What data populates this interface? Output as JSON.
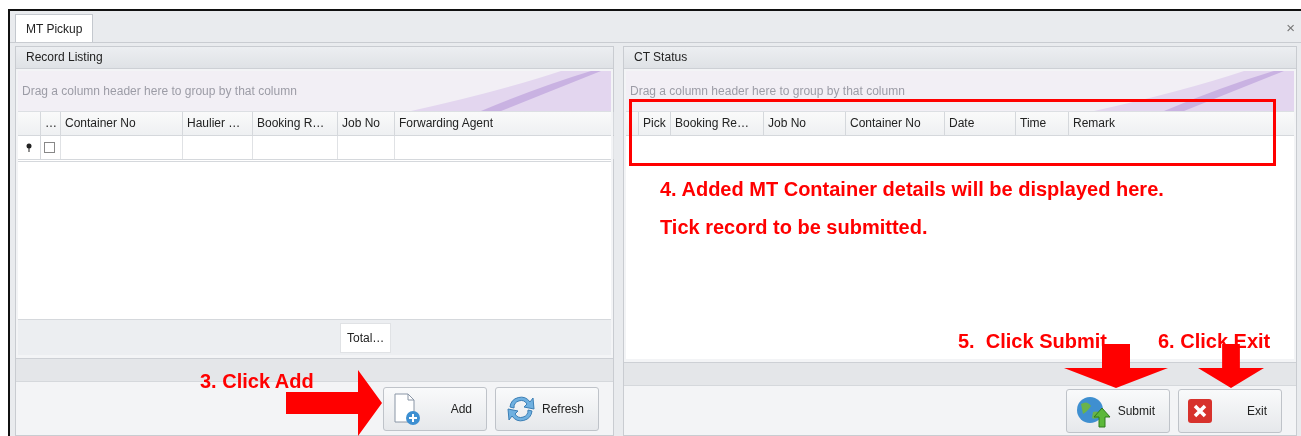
{
  "window": {
    "close": "×"
  },
  "tabs": [
    {
      "label": "MT Pickup",
      "selected": true
    }
  ],
  "left_panel": {
    "title": "Record Listing",
    "group_hint": "Drag a column header here to group by that column",
    "columns": [
      "…",
      "Container No",
      "Haulier …",
      "Booking R…",
      "Job No",
      "Forwarding Agent"
    ],
    "new_row": {
      "checked": false
    },
    "footer_total": "Total…",
    "buttons": [
      {
        "label": "Add"
      },
      {
        "label": "Refresh"
      }
    ]
  },
  "right_panel": {
    "title": "CT Status",
    "group_hint": "Drag a column header here to group by that column",
    "columns": [
      "Pick",
      "Booking Re…",
      "Job No",
      "Container No",
      "Date",
      "Time",
      "Remark"
    ],
    "buttons": [
      {
        "label": "Submit"
      },
      {
        "label": "Exit"
      }
    ]
  },
  "annotations": [
    {
      "kind": "box"
    },
    {
      "kind": "text",
      "text": "4. Added MT Container details will be displayed here. Tick record to be submitted."
    },
    {
      "kind": "text",
      "text": "5.  Click Submit"
    },
    {
      "kind": "text",
      "text": "6. Click Exit"
    },
    {
      "kind": "text",
      "text": "3. Click Add"
    },
    {
      "kind": "arrow"
    },
    {
      "kind": "arrow"
    },
    {
      "kind": "arrow"
    }
  ]
}
